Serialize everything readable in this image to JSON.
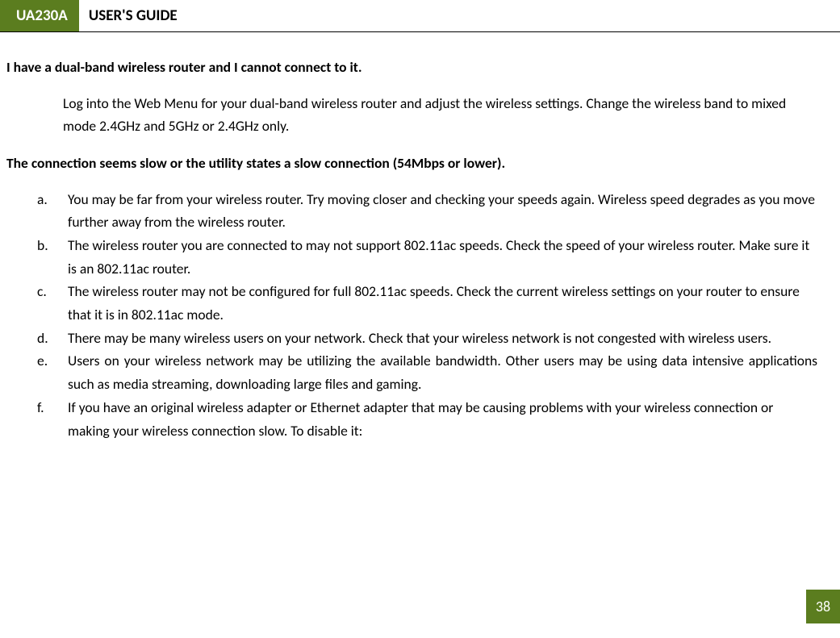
{
  "header": {
    "model": "UA230A",
    "title": "USER'S GUIDE"
  },
  "sections": [
    {
      "heading": "I have a dual-band wireless router and I cannot connect to it.",
      "paragraph": "Log into the Web Menu for your dual-band wireless router and adjust the wireless settings. Change the wireless band to mixed mode 2.4GHz and 5GHz or 2.4GHz only."
    },
    {
      "heading": "The connection seems slow or the utility states a slow connection (54Mbps or lower).",
      "list": [
        {
          "marker": "a.",
          "text": "You may be far from your wireless router. Try moving closer and checking your speeds again. Wireless speed degrades as you move further away from the wireless router."
        },
        {
          "marker": "b.",
          "text": "The wireless router you are connected to may not support 802.11ac speeds. Check the speed of your wireless router. Make sure it is an 802.11ac router."
        },
        {
          "marker": "c.",
          "text": "The wireless router may not be configured for full 802.11ac speeds. Check the current wireless settings on your router to ensure that it is in 802.11ac mode."
        },
        {
          "marker": "d.",
          "text": "There may be many wireless users on your network. Check that your wireless network is not congested with wireless users."
        },
        {
          "marker": "e.",
          "text": "Users on your wireless network may be utilizing the available bandwidth. Other users may be using data intensive applications such as media streaming, downloading large files and gaming.",
          "justify": true
        },
        {
          "marker": "f.",
          "text": "If you have an original wireless adapter or Ethernet adapter that may be causing problems with your wireless connection or making your wireless connection slow. To disable it:"
        }
      ]
    }
  ],
  "page_number": "38"
}
